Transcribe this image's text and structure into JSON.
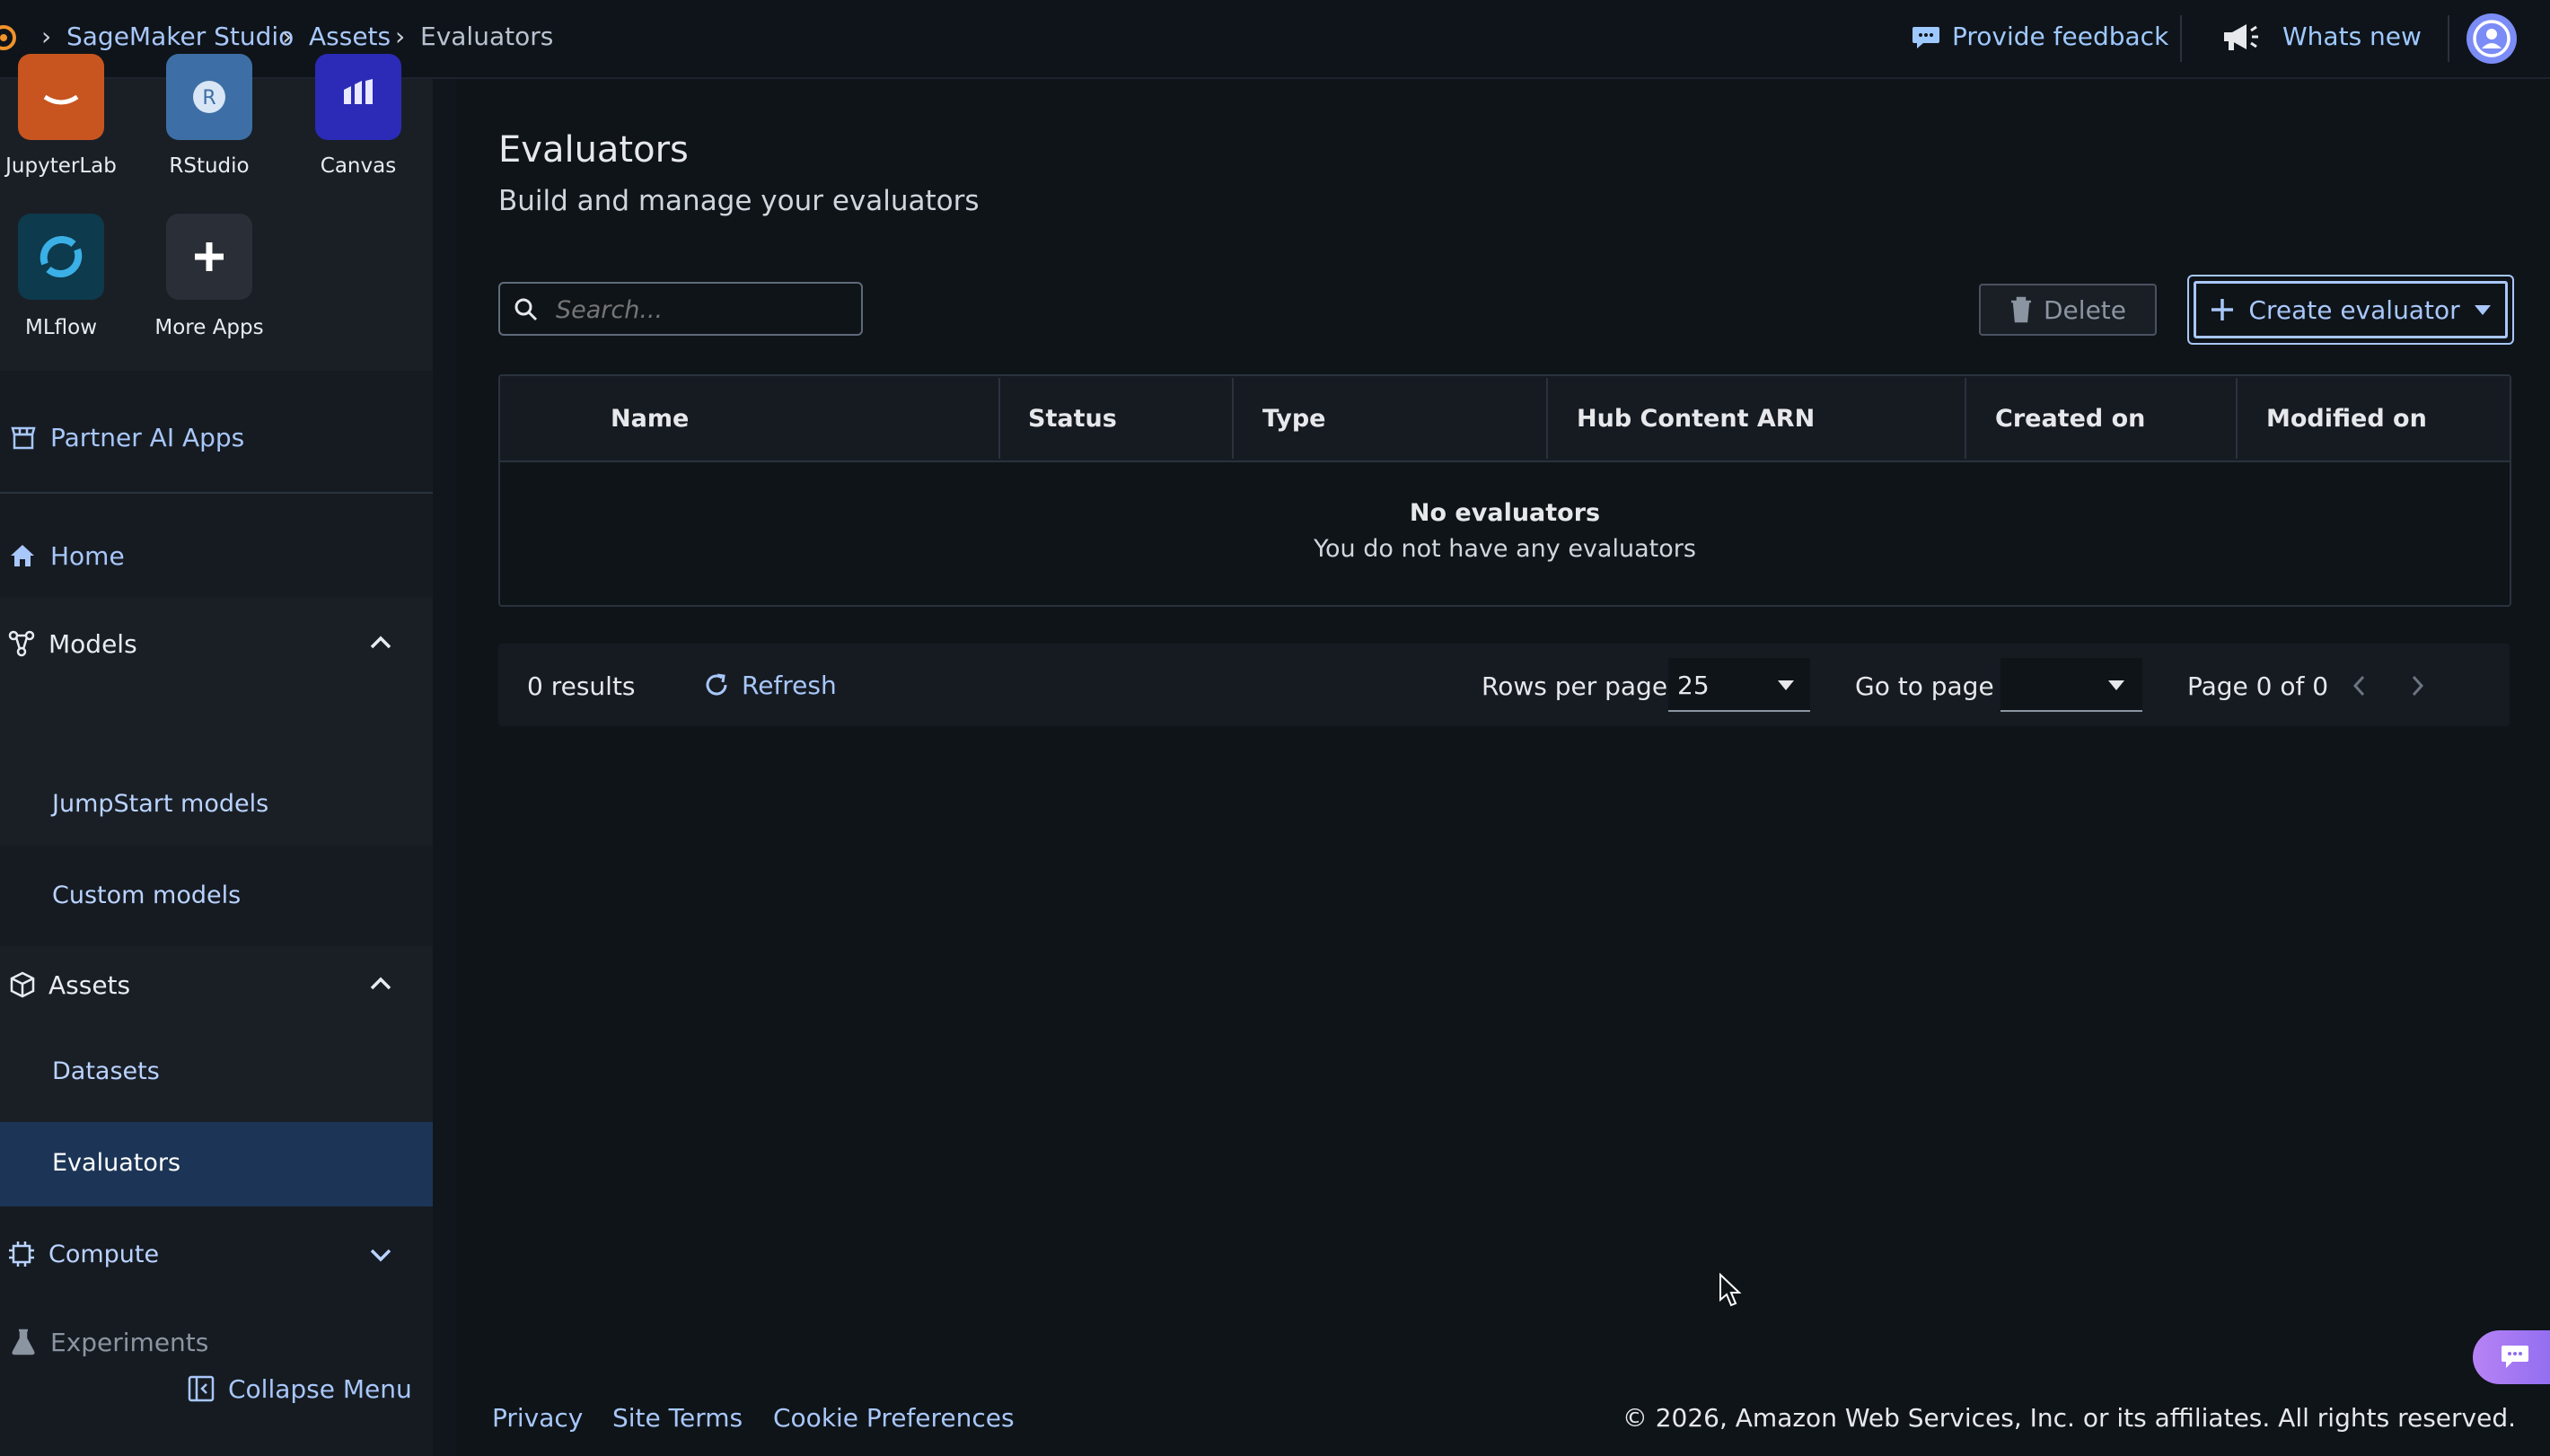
{
  "breadcrumb": {
    "items": [
      "SageMaker Studio",
      "Assets",
      "Evaluators"
    ]
  },
  "topbar": {
    "feedback_label": "Provide feedback",
    "whats_new_label": "Whats new"
  },
  "apps": [
    {
      "label": "JupyterLab",
      "color": "#c8541f"
    },
    {
      "label": "RStudio",
      "color": "#3d6fa6"
    },
    {
      "label": "Canvas",
      "color": "#2b2bb8"
    },
    {
      "label": "MLflow",
      "color": "#0d3a4d"
    },
    {
      "label": "More Apps",
      "color": "#2a2f37"
    }
  ],
  "sidebar": {
    "partner_label": "Partner AI Apps",
    "home_label": "Home",
    "models_label": "Models",
    "jumpstart_label": "JumpStart models",
    "custom_label": "Custom models",
    "assets_label": "Assets",
    "datasets_label": "Datasets",
    "evaluators_label": "Evaluators",
    "compute_label": "Compute",
    "experiments_label": "Experiments",
    "collapse_label": "Collapse Menu"
  },
  "page": {
    "title": "Evaluators",
    "subtitle": "Build and manage your evaluators"
  },
  "search": {
    "placeholder": "Search..."
  },
  "actions": {
    "delete_label": "Delete",
    "create_label": "Create evaluator"
  },
  "table": {
    "columns": [
      "Name",
      "Status",
      "Type",
      "Hub Content ARN",
      "Created on",
      "Modified on"
    ],
    "empty_title": "No evaluators",
    "empty_text": "You do not have any evaluators"
  },
  "pagination": {
    "results": "0 results",
    "refresh_label": "Refresh",
    "rows_label": "Rows per page",
    "rows_value": "25",
    "goto_label": "Go to page",
    "goto_value": "",
    "page_text": "Page 0 of 0"
  },
  "footer": {
    "privacy": "Privacy",
    "terms": "Site Terms",
    "cookies": "Cookie Preferences",
    "copyright": "© 2026, Amazon Web Services, Inc. or its affiliates. All rights reserved."
  },
  "colors": {
    "accent": "#8fb8ff",
    "primary_border": "#a8c7fa",
    "selected_nav": "#1c3556"
  }
}
